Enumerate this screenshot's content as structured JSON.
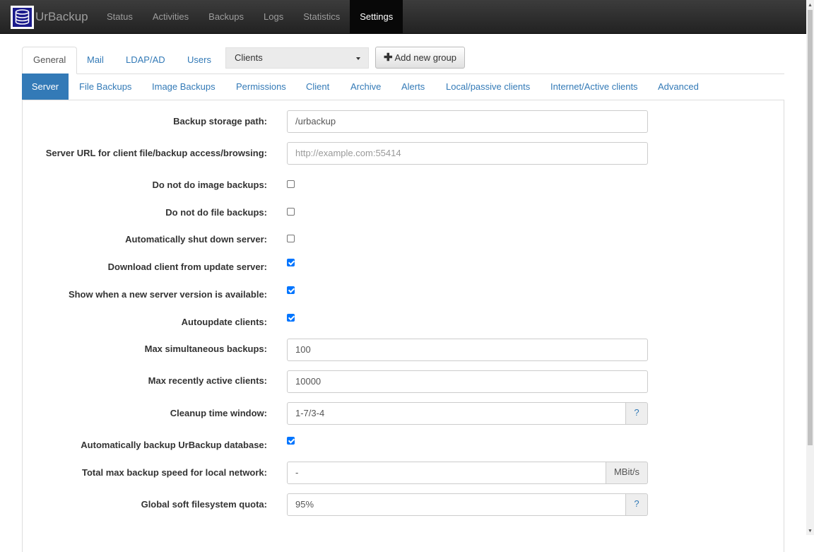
{
  "app": {
    "brand": "UrBackup"
  },
  "nav": [
    "Status",
    "Activities",
    "Backups",
    "Logs",
    "Statistics",
    "Settings"
  ],
  "nav_active": "Settings",
  "main_tabs": [
    "General",
    "Mail",
    "LDAP/AD",
    "Users"
  ],
  "group_select": {
    "value": "Clients"
  },
  "add_group_label": "Add new group",
  "sub_tabs": [
    "Server",
    "File Backups",
    "Image Backups",
    "Permissions",
    "Client",
    "Archive",
    "Alerts",
    "Local/passive clients",
    "Internet/Active clients",
    "Advanced"
  ],
  "settings": {
    "backup_storage_path": {
      "label": "Backup storage path:",
      "value": "/urbackup"
    },
    "server_url": {
      "label": "Server URL for client file/backup access/browsing:",
      "value": "",
      "placeholder": "http://example.com:55414"
    },
    "no_image_backups": {
      "label": "Do not do image backups:",
      "checked": false
    },
    "no_file_backups": {
      "label": "Do not do file backups:",
      "checked": false
    },
    "auto_shutdown": {
      "label": "Automatically shut down server:",
      "checked": false
    },
    "download_client": {
      "label": "Download client from update server:",
      "checked": true
    },
    "show_new_version": {
      "label": "Show when a new server version is available:",
      "checked": true
    },
    "autoupdate_clients": {
      "label": "Autoupdate clients:",
      "checked": true
    },
    "max_simultaneous": {
      "label": "Max simultaneous backups:",
      "value": "100"
    },
    "max_recent_clients": {
      "label": "Max recently active clients:",
      "value": "10000"
    },
    "cleanup_window": {
      "label": "Cleanup time window:",
      "value": "1-7/3-4",
      "addon": "?"
    },
    "backup_db": {
      "label": "Automatically backup UrBackup database:",
      "checked": true
    },
    "max_speed_local": {
      "label": "Total max backup speed for local network:",
      "value": "-",
      "addon": "MBit/s"
    },
    "soft_quota": {
      "label": "Global soft filesystem quota:",
      "value": "95%",
      "addon": "?"
    }
  }
}
